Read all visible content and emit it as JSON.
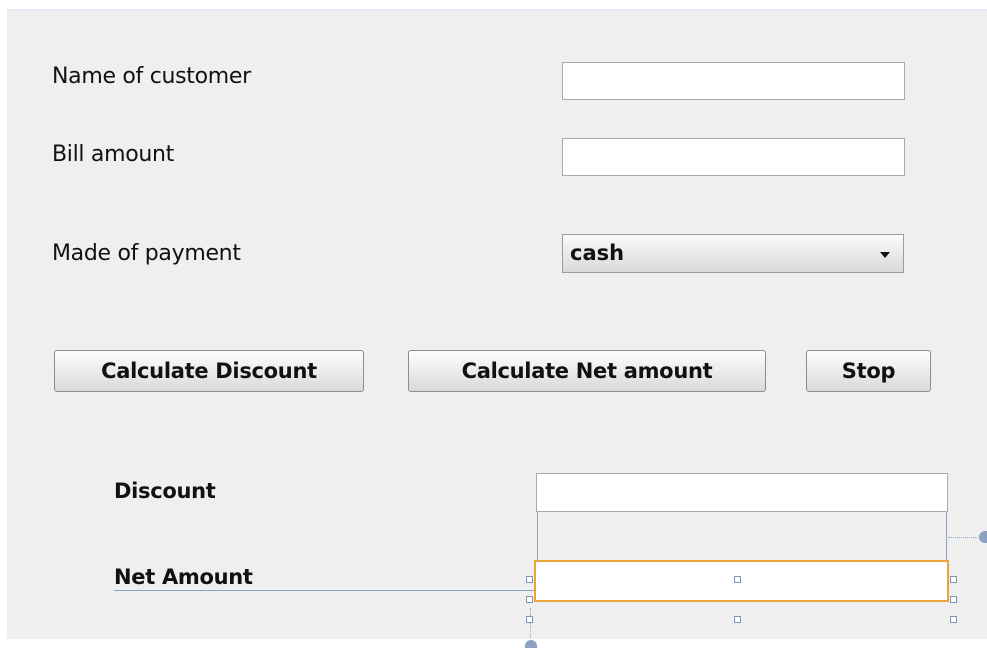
{
  "form": {
    "name_label": "Name of customer",
    "name_value": "",
    "bill_label": "Bill amount",
    "bill_value": "",
    "payment_label": "Made of payment",
    "payment_selected": "cash",
    "calc_discount_button": "Calculate Discount",
    "calc_net_button": "Calculate Net amount",
    "stop_button": "Stop",
    "discount_label": "Discount",
    "discount_value": "",
    "net_label": "Net Amount",
    "net_value": ""
  },
  "colors": {
    "selection_border": "#e8a53a",
    "guide_line": "#8ca0c0",
    "panel_background": "#efefef"
  }
}
